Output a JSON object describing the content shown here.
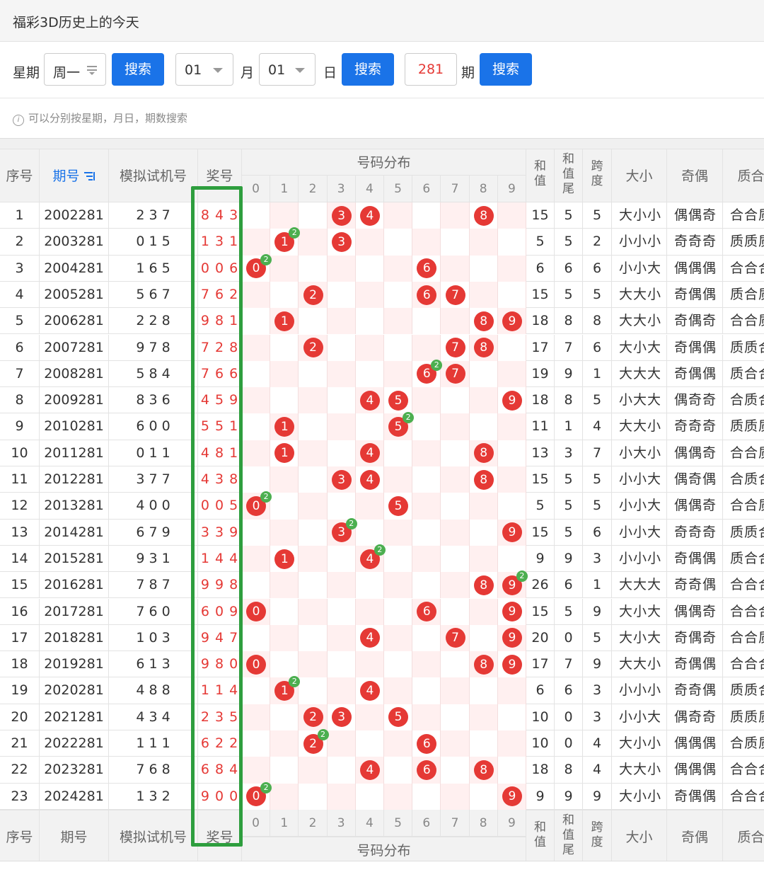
{
  "panel": {
    "title": "福彩3D历史上的今天",
    "weekday_label": "星期",
    "weekday_value": "周一",
    "search_label": "搜索",
    "month_value": "01",
    "month_label": "月",
    "day_value": "01",
    "day_label": "日",
    "issue_value": "281",
    "issue_label": "期",
    "hint": "可以分别按星期，月日，期数搜索"
  },
  "table": {
    "headers": {
      "seq": "序号",
      "issue": "期号",
      "sim": "模拟试机号",
      "prize": "奖号",
      "dist": "号码分布",
      "sum": "和值",
      "tail": "和值尾",
      "span": "跨度",
      "size": "大小",
      "odd": "奇偶",
      "prime": "质合"
    },
    "digits": [
      "0",
      "1",
      "2",
      "3",
      "4",
      "5",
      "6",
      "7",
      "8",
      "9"
    ],
    "rows": [
      {
        "seq": "1",
        "issue": "2002281",
        "sim": "2 3 7",
        "prize": "8 4 3",
        "sum": "15",
        "tail": "5",
        "span": "5",
        "size": "大小小",
        "odd": "偶偶奇",
        "prime": "合合质"
      },
      {
        "seq": "2",
        "issue": "2003281",
        "sim": "0 1 5",
        "prize": "1 3 1",
        "sum": "5",
        "tail": "5",
        "span": "2",
        "size": "小小小",
        "odd": "奇奇奇",
        "prime": "质质质"
      },
      {
        "seq": "3",
        "issue": "2004281",
        "sim": "1 6 5",
        "prize": "0 0 6",
        "sum": "6",
        "tail": "6",
        "span": "6",
        "size": "小小大",
        "odd": "偶偶偶",
        "prime": "合合合"
      },
      {
        "seq": "4",
        "issue": "2005281",
        "sim": "5 6 7",
        "prize": "7 6 2",
        "sum": "15",
        "tail": "5",
        "span": "5",
        "size": "大大小",
        "odd": "奇偶偶",
        "prime": "质合质"
      },
      {
        "seq": "5",
        "issue": "2006281",
        "sim": "2 2 8",
        "prize": "9 8 1",
        "sum": "18",
        "tail": "8",
        "span": "8",
        "size": "大大小",
        "odd": "奇偶奇",
        "prime": "合合质"
      },
      {
        "seq": "6",
        "issue": "2007281",
        "sim": "9 7 8",
        "prize": "7 2 8",
        "sum": "17",
        "tail": "7",
        "span": "6",
        "size": "大小大",
        "odd": "奇偶偶",
        "prime": "质质合"
      },
      {
        "seq": "7",
        "issue": "2008281",
        "sim": "5 8 4",
        "prize": "7 6 6",
        "sum": "19",
        "tail": "9",
        "span": "1",
        "size": "大大大",
        "odd": "奇偶偶",
        "prime": "质合合"
      },
      {
        "seq": "8",
        "issue": "2009281",
        "sim": "8 3 6",
        "prize": "4 5 9",
        "sum": "18",
        "tail": "8",
        "span": "5",
        "size": "小大大",
        "odd": "偶奇奇",
        "prime": "合质合"
      },
      {
        "seq": "9",
        "issue": "2010281",
        "sim": "6 0 0",
        "prize": "5 5 1",
        "sum": "11",
        "tail": "1",
        "span": "4",
        "size": "大大小",
        "odd": "奇奇奇",
        "prime": "质质质"
      },
      {
        "seq": "10",
        "issue": "2011281",
        "sim": "0 1 1",
        "prize": "4 8 1",
        "sum": "13",
        "tail": "3",
        "span": "7",
        "size": "小大小",
        "odd": "偶偶奇",
        "prime": "合合质"
      },
      {
        "seq": "11",
        "issue": "2012281",
        "sim": "3 7 7",
        "prize": "4 3 8",
        "sum": "15",
        "tail": "5",
        "span": "5",
        "size": "小小大",
        "odd": "偶奇偶",
        "prime": "合质合"
      },
      {
        "seq": "12",
        "issue": "2013281",
        "sim": "4 0 0",
        "prize": "0 0 5",
        "sum": "5",
        "tail": "5",
        "span": "5",
        "size": "小小大",
        "odd": "偶偶奇",
        "prime": "合合质"
      },
      {
        "seq": "13",
        "issue": "2014281",
        "sim": "6 7 9",
        "prize": "3 3 9",
        "sum": "15",
        "tail": "5",
        "span": "6",
        "size": "小小大",
        "odd": "奇奇奇",
        "prime": "质质合"
      },
      {
        "seq": "14",
        "issue": "2015281",
        "sim": "9 3 1",
        "prize": "1 4 4",
        "sum": "9",
        "tail": "9",
        "span": "3",
        "size": "小小小",
        "odd": "奇偶偶",
        "prime": "质合合"
      },
      {
        "seq": "15",
        "issue": "2016281",
        "sim": "7 8 7",
        "prize": "9 9 8",
        "sum": "26",
        "tail": "6",
        "span": "1",
        "size": "大大大",
        "odd": "奇奇偶",
        "prime": "合合合"
      },
      {
        "seq": "16",
        "issue": "2017281",
        "sim": "7 6 0",
        "prize": "6 0 9",
        "sum": "15",
        "tail": "5",
        "span": "9",
        "size": "大小大",
        "odd": "偶偶奇",
        "prime": "合合合"
      },
      {
        "seq": "17",
        "issue": "2018281",
        "sim": "1 0 3",
        "prize": "9 4 7",
        "sum": "20",
        "tail": "0",
        "span": "5",
        "size": "大小大",
        "odd": "奇偶奇",
        "prime": "合合质"
      },
      {
        "seq": "18",
        "issue": "2019281",
        "sim": "6 1 3",
        "prize": "9 8 0",
        "sum": "17",
        "tail": "7",
        "span": "9",
        "size": "大大小",
        "odd": "奇偶偶",
        "prime": "合合合"
      },
      {
        "seq": "19",
        "issue": "2020281",
        "sim": "4 8 8",
        "prize": "1 1 4",
        "sum": "6",
        "tail": "6",
        "span": "3",
        "size": "小小小",
        "odd": "奇奇偶",
        "prime": "质质合"
      },
      {
        "seq": "20",
        "issue": "2021281",
        "sim": "4 3 4",
        "prize": "2 3 5",
        "sum": "10",
        "tail": "0",
        "span": "3",
        "size": "小小大",
        "odd": "偶奇奇",
        "prime": "质质质"
      },
      {
        "seq": "21",
        "issue": "2022281",
        "sim": "1 1 1",
        "prize": "6 2 2",
        "sum": "10",
        "tail": "0",
        "span": "4",
        "size": "大小小",
        "odd": "偶偶偶",
        "prime": "合质质"
      },
      {
        "seq": "22",
        "issue": "2023281",
        "sim": "7 6 8",
        "prize": "6 8 4",
        "sum": "18",
        "tail": "8",
        "span": "4",
        "size": "大大小",
        "odd": "偶偶偶",
        "prime": "合合合"
      },
      {
        "seq": "23",
        "issue": "2024281",
        "sim": "1 3 2",
        "prize": "9 0 0",
        "sum": "9",
        "tail": "9",
        "span": "9",
        "size": "大小小",
        "odd": "奇偶偶",
        "prime": "合合合"
      }
    ]
  },
  "colors": {
    "button": "#1a73e8",
    "ball": "#e53935",
    "repeat_badge": "#4caf50",
    "highlight_box": "#2e9e3e",
    "stripe": "#fff0f0"
  }
}
